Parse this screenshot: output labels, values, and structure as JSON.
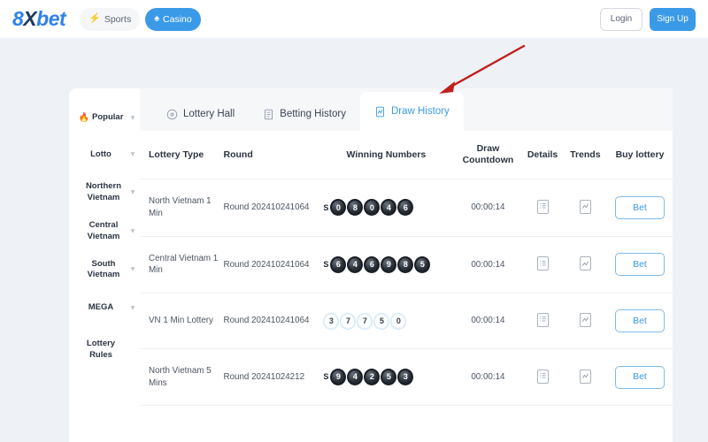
{
  "header": {
    "logo_part1": "8",
    "logo_x": "X",
    "logo_part2": "bet",
    "nav": [
      {
        "label": "Sports",
        "icon": "bolt-icon",
        "active": false
      },
      {
        "label": "Casino",
        "icon": "spade-icon",
        "active": true
      }
    ],
    "login_label": "Login",
    "signup_label": "Sign Up"
  },
  "sidebar": {
    "items": [
      {
        "label": "Popular",
        "icon": "fire-icon",
        "chevron": true,
        "sub": false
      },
      {
        "label": "Lotto",
        "icon": "",
        "chevron": true,
        "sub": false
      },
      {
        "label": "Northern Vietnam",
        "icon": "",
        "chevron": true,
        "sub": true
      },
      {
        "label": "Central Vietnam",
        "icon": "",
        "chevron": true,
        "sub": true
      },
      {
        "label": "South Vietnam",
        "icon": "",
        "chevron": true,
        "sub": true
      },
      {
        "label": "MEGA",
        "icon": "",
        "chevron": true,
        "sub": false
      },
      {
        "label": "Lottery Rules",
        "icon": "",
        "chevron": false,
        "sub": false
      }
    ]
  },
  "tabs": [
    {
      "label": "Lottery Hall",
      "icon": "target-icon",
      "active": false
    },
    {
      "label": "Betting History",
      "icon": "document-list-icon",
      "active": false
    },
    {
      "label": "Draw History",
      "icon": "chart-line-icon",
      "active": true
    }
  ],
  "table": {
    "headers": {
      "lottery_type": "Lottery Type",
      "round": "Round",
      "winning_numbers": "Winning Numbers",
      "draw_countdown": "Draw Countdown",
      "details": "Details",
      "trends": "Trends",
      "buy_lottery": "Buy lottery"
    },
    "rows": [
      {
        "lottery_type": "North Vietnam 1 Min",
        "round": "Round 202410241064",
        "prefix": "S",
        "numbers": [
          "0",
          "8",
          "0",
          "4",
          "6"
        ],
        "ball_style": "dark",
        "countdown": "00:00:14",
        "bet_label": "Bet"
      },
      {
        "lottery_type": "Central Vietnam 1 Min",
        "round": "Round 202410241064",
        "prefix": "S",
        "numbers": [
          "6",
          "4",
          "6",
          "9",
          "8",
          "5"
        ],
        "ball_style": "dark",
        "countdown": "00:00:14",
        "bet_label": "Bet"
      },
      {
        "lottery_type": "VN 1 Min Lottery",
        "round": "Round 202410241064",
        "prefix": "",
        "numbers": [
          "3",
          "7",
          "7",
          "5",
          "0"
        ],
        "ball_style": "light",
        "countdown": "00:00:14",
        "bet_label": "Bet"
      },
      {
        "lottery_type": "North Vietnam 5 Mins",
        "round": "Round 20241024212",
        "prefix": "S",
        "numbers": [
          "9",
          "4",
          "2",
          "5",
          "3"
        ],
        "ball_style": "dark",
        "countdown": "00:00:14",
        "bet_label": "Bet"
      }
    ]
  },
  "annotation": {
    "type": "red-arrow",
    "color": "#c02020",
    "points_to": "Draw History"
  },
  "colors": {
    "accent_blue": "#3b9ae8",
    "page_bg": "#eef1f5",
    "card_bg": "#ffffff",
    "tabbar_bg": "#f6f7f9"
  }
}
